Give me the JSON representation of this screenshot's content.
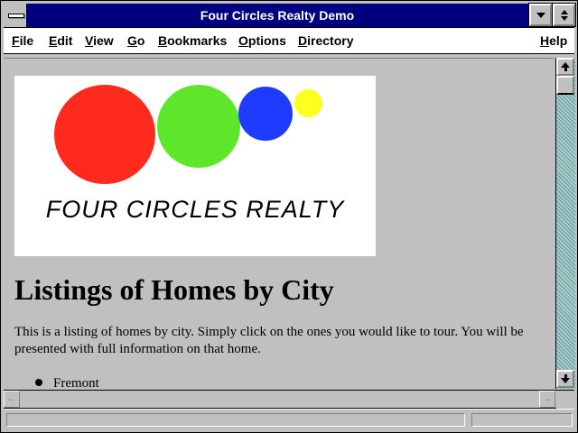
{
  "window": {
    "title": "Four Circles Realty Demo"
  },
  "menu": {
    "items": [
      {
        "label": "File"
      },
      {
        "label": "Edit"
      },
      {
        "label": "View"
      },
      {
        "label": "Go"
      },
      {
        "label": "Bookmarks"
      },
      {
        "label": "Options"
      },
      {
        "label": "Directory"
      },
      {
        "label": "Help"
      }
    ]
  },
  "logo": {
    "text": "FOUR CIRCLES REALTY",
    "circle_colors": [
      "#ff2a1e",
      "#5ee62a",
      "#1e3cff",
      "#ffff1e"
    ]
  },
  "page": {
    "heading": "Listings of Homes by City",
    "intro": "This is a listing of homes by city. Simply click on the ones you would like to tour. You will be presented with full information on that home.",
    "cities": [
      "Fremont"
    ]
  },
  "status": {
    "text": ""
  },
  "colors": {
    "titlebar": "#000080",
    "desktop": "#008080",
    "chrome": "#c0c0c0"
  }
}
